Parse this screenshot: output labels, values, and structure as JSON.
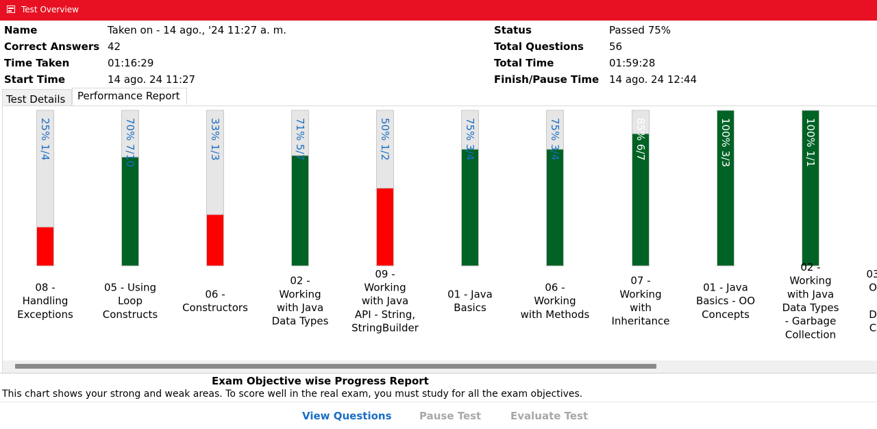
{
  "window": {
    "title": "Test Overview"
  },
  "summary": {
    "name_label": "Name",
    "name_value": "Taken on - 14 ago., '24 11:27 a. m.",
    "correct_label": "Correct Answers",
    "correct_value": "42",
    "time_taken_label": "Time Taken",
    "time_taken_value": "01:16:29",
    "start_label": "Start Time",
    "start_value": "14 ago. 24 11:27",
    "status_label": "Status",
    "status_value": "Passed 75%",
    "total_q_label": "Total Questions",
    "total_q_value": "56",
    "total_time_label": "Total Time",
    "total_time_value": "01:59:28",
    "finish_label": "Finish/Pause Time",
    "finish_value": "14 ago. 24 12:44"
  },
  "tabs": {
    "details": "Test Details",
    "performance": "Performance Report",
    "active": "performance"
  },
  "colors": {
    "pass": "#006225",
    "fail": "#ff0000",
    "track": "#e6e6e6",
    "label_on_track": "#1a6ec4",
    "label_on_bar": "#ffffff"
  },
  "chart_data": {
    "type": "bar",
    "orientation": "vertical",
    "ylim": [
      0,
      100
    ],
    "categories": [
      "08 - Handling Exceptions",
      "05 - Using Loop Constructs",
      "06 - Constructors",
      "02 - Working with Java Data Types",
      "09 - Working with Java API - String, StringBuilder",
      "01 - Java Basics",
      "06 - Working with Methods",
      "07 - Working with Inheritance",
      "01 - Java Basics - OO Concepts",
      "02 - Working with Java Data Types - Garbage Collection",
      "03"
    ],
    "category_lines": [
      [
        "08 -",
        "Handling",
        "Exceptions"
      ],
      [
        "05 - Using",
        "Loop",
        "Constructs"
      ],
      [
        "06 -",
        "Constructors"
      ],
      [
        "02 -",
        "Working",
        "with Java",
        "Data Types"
      ],
      [
        "09 -",
        "Working",
        "with Java",
        "API - String,",
        "StringBuilder"
      ],
      [
        "01 - Java",
        "Basics"
      ],
      [
        "06 -",
        "Working",
        "with Methods"
      ],
      [
        "07 -",
        "Working",
        "with",
        "Inheritance"
      ],
      [
        "01 - Java",
        "Basics - OO",
        "Concepts"
      ],
      [
        "02 -",
        "Working",
        "with Java",
        "Data Types",
        "- Garbage",
        "Collection"
      ],
      [
        "03",
        "O",
        "",
        "D",
        "C"
      ]
    ],
    "values": [
      25,
      70,
      33,
      71,
      50,
      75,
      75,
      85,
      100,
      100,
      null
    ],
    "bar_labels": [
      "25% 1/4",
      "70% 7/10",
      "33% 1/3",
      "71% 5/7",
      "50% 1/2",
      "75% 3/4",
      "75% 3/4",
      "85% 6/7",
      "100% 3/3",
      "100% 1/1",
      ""
    ],
    "status": [
      "fail",
      "pass",
      "fail",
      "pass",
      "fail",
      "pass",
      "pass",
      "pass",
      "pass",
      "pass",
      null
    ]
  },
  "report": {
    "title": "Exam Objective wise Progress Report",
    "description": "This chart shows your strong and weak areas. To score well in the real exam, you must study for all the exam objectives."
  },
  "footer": {
    "view": "View Questions",
    "pause": "Pause Test",
    "evaluate": "Evaluate Test"
  }
}
